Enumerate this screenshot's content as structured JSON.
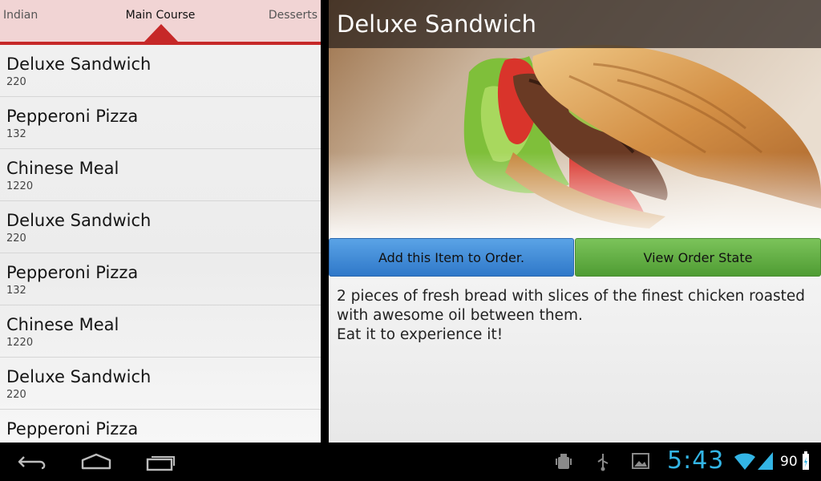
{
  "tabs": {
    "items": [
      "Indian",
      "Main Course",
      "Desserts"
    ],
    "active_index": 1
  },
  "menu": {
    "items": [
      {
        "name": "Deluxe Sandwich",
        "price": "220"
      },
      {
        "name": "Pepperoni Pizza",
        "price": "132"
      },
      {
        "name": "Chinese Meal",
        "price": "1220"
      },
      {
        "name": "Deluxe Sandwich",
        "price": "220"
      },
      {
        "name": "Pepperoni Pizza",
        "price": "132"
      },
      {
        "name": "Chinese Meal",
        "price": "1220"
      },
      {
        "name": "Deluxe Sandwich",
        "price": "220"
      },
      {
        "name": "Pepperoni Pizza",
        "price": ""
      }
    ]
  },
  "detail": {
    "title": "Deluxe Sandwich",
    "add_label": "Add this Item to Order.",
    "view_label": "View Order State",
    "description": "2 pieces of fresh bread with slices of the finest chicken roasted with awesome oil between them.\n Eat it to experience it!"
  },
  "status": {
    "clock": "5:43",
    "battery": "90"
  },
  "colors": {
    "accent": "#c62828",
    "tab_bg": "#f1d4d4",
    "add_button": "#3a86d6",
    "view_button": "#5fad40",
    "clock": "#33b5e5"
  },
  "icons": {
    "nav": [
      "back-icon",
      "home-icon",
      "recent-apps-icon"
    ],
    "status": [
      "android-debug-icon",
      "usb-icon",
      "image-notification-icon",
      "wifi-icon",
      "signal-icon",
      "battery-icon"
    ]
  }
}
